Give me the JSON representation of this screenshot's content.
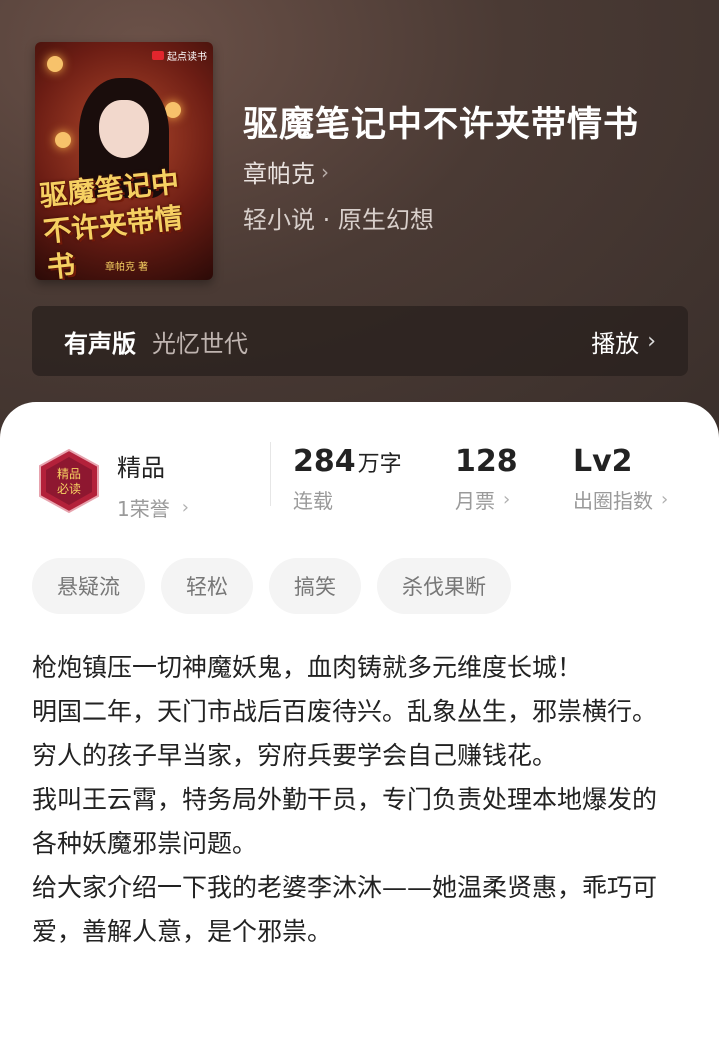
{
  "book": {
    "title": "驱魔笔记中不许夹带情书",
    "author": "章帕克",
    "genre": "轻小说 · 原生幻想",
    "cover": {
      "publisher_tag": "起点读书",
      "title_art": "驱魔笔记中不许夹带情书",
      "author_art": "章帕克 著"
    }
  },
  "audio": {
    "label": "有声版",
    "publisher": "光忆世代",
    "play_label": "播放"
  },
  "stats": {
    "quality": {
      "title": "精品",
      "honor": "1荣誉",
      "badge_text": "精品必读"
    },
    "words": {
      "value": "284",
      "unit": "万字",
      "label": "连载"
    },
    "monthly_votes": {
      "value": "128",
      "label": "月票"
    },
    "popularity": {
      "value": "Lv2",
      "label": "出圈指数"
    }
  },
  "tags": [
    "悬疑流",
    "轻松",
    "搞笑",
    "杀伐果断"
  ],
  "description": [
    "枪炮镇压一切神魔妖鬼，血肉铸就多元维度长城！",
    "明国二年，天门市战后百废待兴。乱象丛生，邪祟横行。",
    "穷人的孩子早当家，穷府兵要学会自己赚钱花。",
    "我叫王云霄，特务局外勤干员，专门负责处理本地爆发的各种妖魔邪祟问题。",
    "给大家介绍一下我的老婆李沐沐——她温柔贤惠，乖巧可爱，善解人意，是个邪祟。"
  ],
  "colors": {
    "hero_bg": "#4a3a34",
    "card_bg": "#ffffff",
    "tag_bg": "#f4f4f4",
    "badge_red": "#b3213a",
    "cover_title_gold": "#f6d062"
  }
}
